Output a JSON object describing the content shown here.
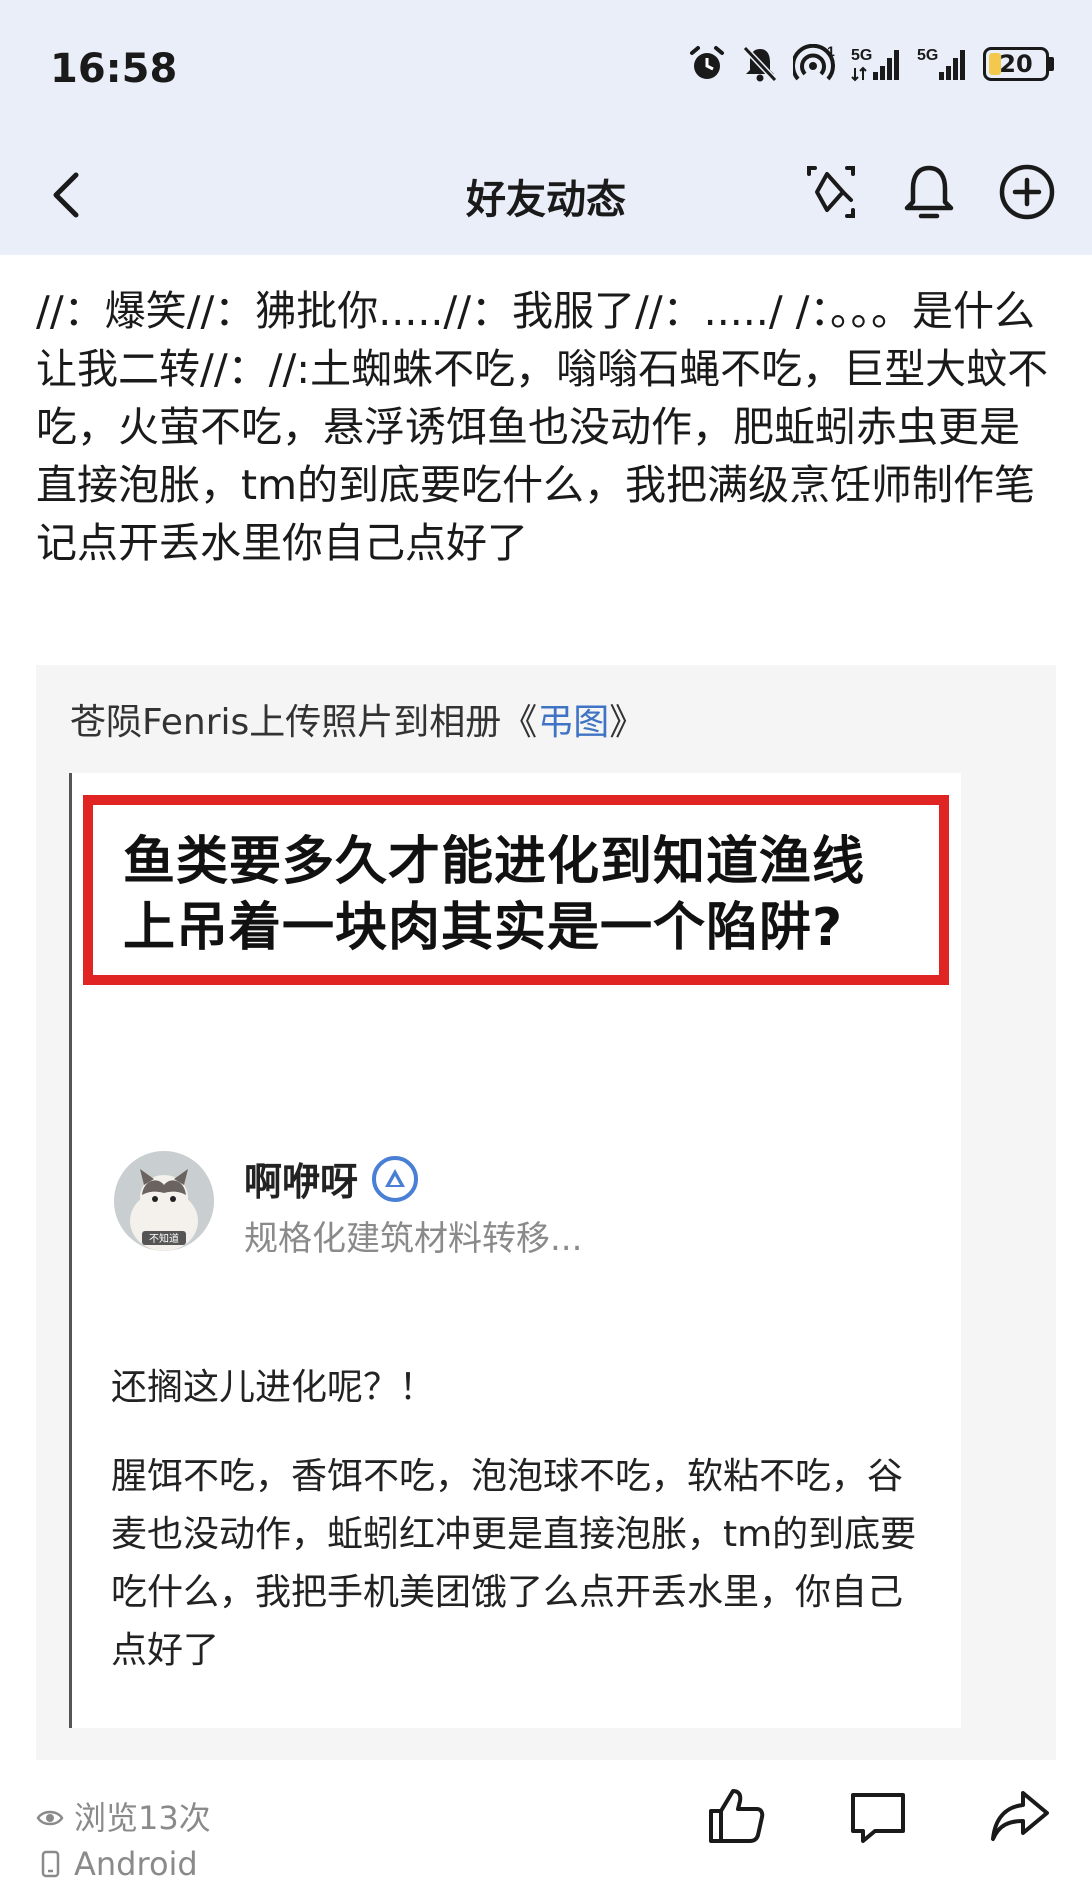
{
  "status_bar": {
    "time": "16:58",
    "signal_1_label": "5G",
    "signal_2_label": "5G",
    "sim_index": "1",
    "battery_level": "20",
    "battery_fraction": 0.2,
    "battery_color": "#f2c94c",
    "icons": [
      "alarm-icon",
      "mute-bell-icon",
      "hotspot-icon",
      "signal-5g-icon",
      "signal-5g-icon",
      "battery-icon"
    ]
  },
  "nav": {
    "title": "好友动态",
    "back_icon": "back-arrow-icon",
    "action_icons": [
      "sparkle-diamond-icon",
      "bell-icon",
      "add-circle-icon"
    ]
  },
  "post": {
    "text": "//：爆笑//：狒批你.....//：我服了//：...../ /：。。。是什么让我二转//：//:土蜘蛛不吃，嗡嗡石蝇不吃，巨型大蚊不吃，火萤不吃，悬浮诱饵鱼也没动作，肥蚯蚓赤虫更是直接泡胀，tm的到底要吃什么，我把满级烹饪师制作笔记点开丢水里你自己点好了"
  },
  "share": {
    "uploader_prefix": "苍陨Fenris上传照片到相册《",
    "album_name": "弔图",
    "suffix": "》",
    "link_color": "#3f74c5",
    "image": {
      "headline": "鱼类要多久才能进化到知道渔线上吊着一块肉其实是一个陷阱?",
      "headline_border_color": "#e02323",
      "author_name": "啊咿呀",
      "author_desc": "规格化建筑材料转移...",
      "avatar_caption": "不知道",
      "quote_question": "还搁这儿进化呢？！",
      "quote_body": "腥饵不吃，香饵不吃，泡泡球不吃，软粘不吃，谷麦也没动作，蚯蚓红冲更是直接泡胀，tm的到底要吃什么，我把手机美团饿了么点开丢水里，你自己点好了"
    }
  },
  "footer": {
    "views": "浏览13次",
    "device": "Android",
    "action_icons": [
      "thumbs-up-icon",
      "comment-icon",
      "share-icon"
    ]
  }
}
